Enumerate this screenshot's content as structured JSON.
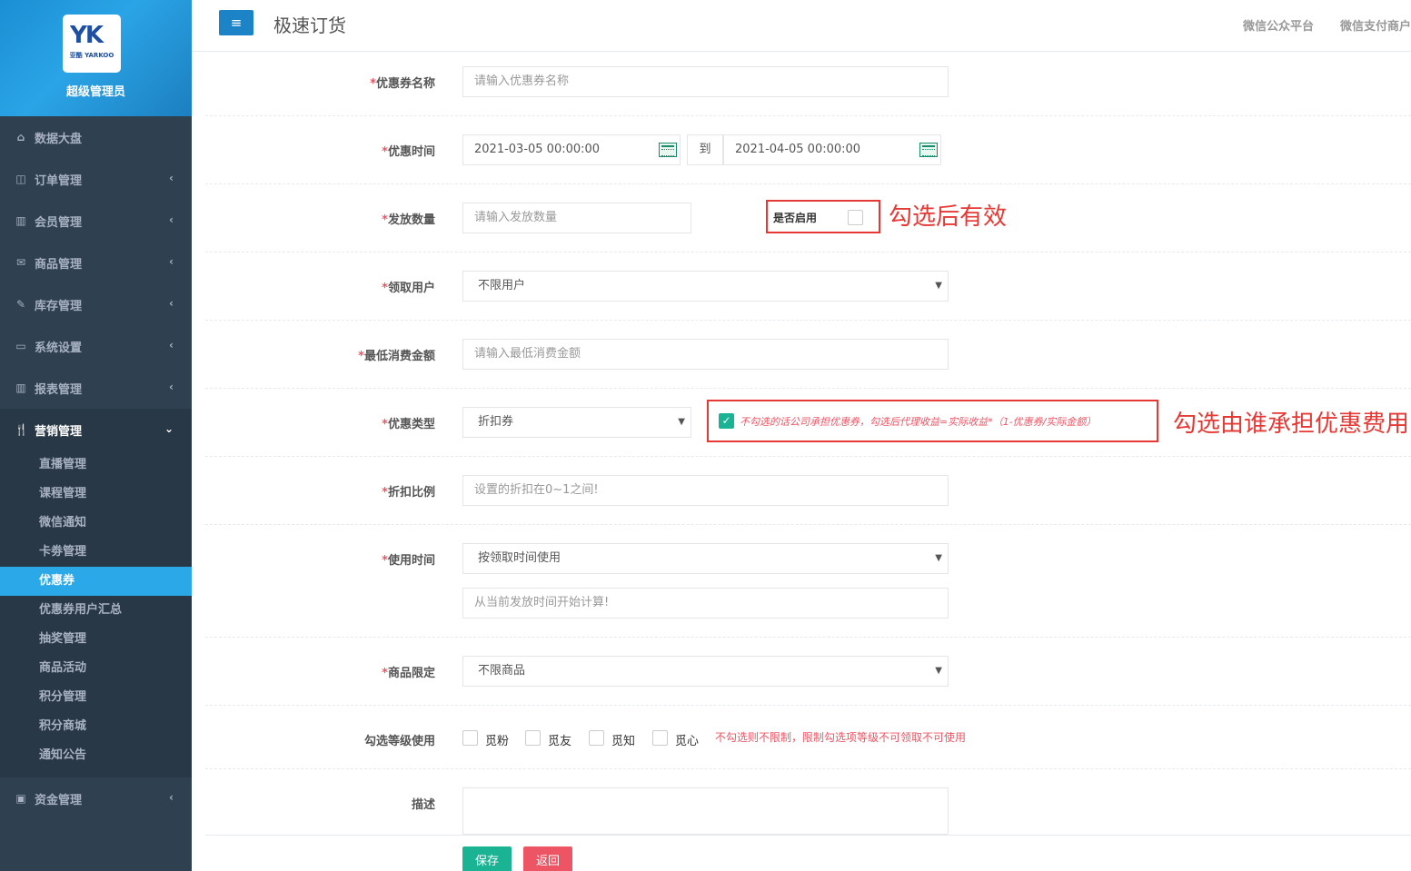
{
  "sidebar": {
    "logo_mark": "YK",
    "logo_text": "亚酷 YARKOO",
    "user_name": "超级管理员",
    "items": [
      {
        "label": "数据大盘",
        "icon": "home-icon"
      },
      {
        "label": "订单管理",
        "icon": "columns-icon"
      },
      {
        "label": "会员管理",
        "icon": "bar-chart-icon"
      },
      {
        "label": "商品管理",
        "icon": "envelope-icon"
      },
      {
        "label": "库存管理",
        "icon": "edit-icon"
      },
      {
        "label": "系统设置",
        "icon": "desktop-icon"
      },
      {
        "label": "报表管理",
        "icon": "bar-chart-icon"
      },
      {
        "label": "营销管理",
        "icon": "cutlery-icon"
      }
    ],
    "marketing_sub": [
      "直播管理",
      "课程管理",
      "微信通知",
      "卡劵管理",
      "优惠券",
      "优惠券用户汇总",
      "抽奖管理",
      "商品活动",
      "积分管理",
      "积分商城",
      "通知公告"
    ],
    "finance": {
      "label": "资金管理",
      "icon": "money-icon"
    }
  },
  "topbar": {
    "title": "极速订货",
    "links": [
      "微信公众平台",
      "微信支付商户"
    ]
  },
  "form": {
    "coupon_name": {
      "label": "优惠券名称",
      "placeholder": "请输入优惠券名称"
    },
    "time": {
      "label": "优惠时间",
      "start": "2021-03-05 00:00:00",
      "sep": "到",
      "end": "2021-04-05 00:00:00"
    },
    "quantity": {
      "label": "发放数量",
      "placeholder": "请输入发放数量",
      "enable_label": "是否启用",
      "annotation": "勾选后有效"
    },
    "receiver": {
      "label": "领取用户",
      "value": "不限用户"
    },
    "min_spend": {
      "label": "最低消费金额",
      "placeholder": "请输入最低消费金额"
    },
    "type": {
      "label": "优惠类型",
      "value": "折扣券",
      "bear_note": "不勾选的话公司承担优惠券，勾选后代理收益=实际收益*（1-优惠券/实际金额）",
      "annotation": "勾选由谁承担优惠费用"
    },
    "discount": {
      "label": "折扣比例",
      "placeholder": "设置的折扣在0~1之间!"
    },
    "use_time": {
      "label": "使用时间",
      "value": "按领取时间使用",
      "placeholder": "从当前发放时间开始计算!"
    },
    "goods": {
      "label": "商品限定",
      "value": "不限商品"
    },
    "levels": {
      "label": "勾选等级使用",
      "options": [
        "觅粉",
        "觅友",
        "觅知",
        "觅心"
      ],
      "hint": "不勾选则不限制，限制勾选项等级不可领取不可使用"
    },
    "desc": {
      "label": "描述"
    },
    "required_mark": "*",
    "save_label": "保存",
    "back_label": "返回"
  },
  "colors": {
    "sidebar": "#2f4050",
    "accent": "#2aa8e8",
    "primary": "#1c84c6",
    "save": "#1ab394",
    "back": "#ed5565",
    "annotation": "#e53935"
  }
}
